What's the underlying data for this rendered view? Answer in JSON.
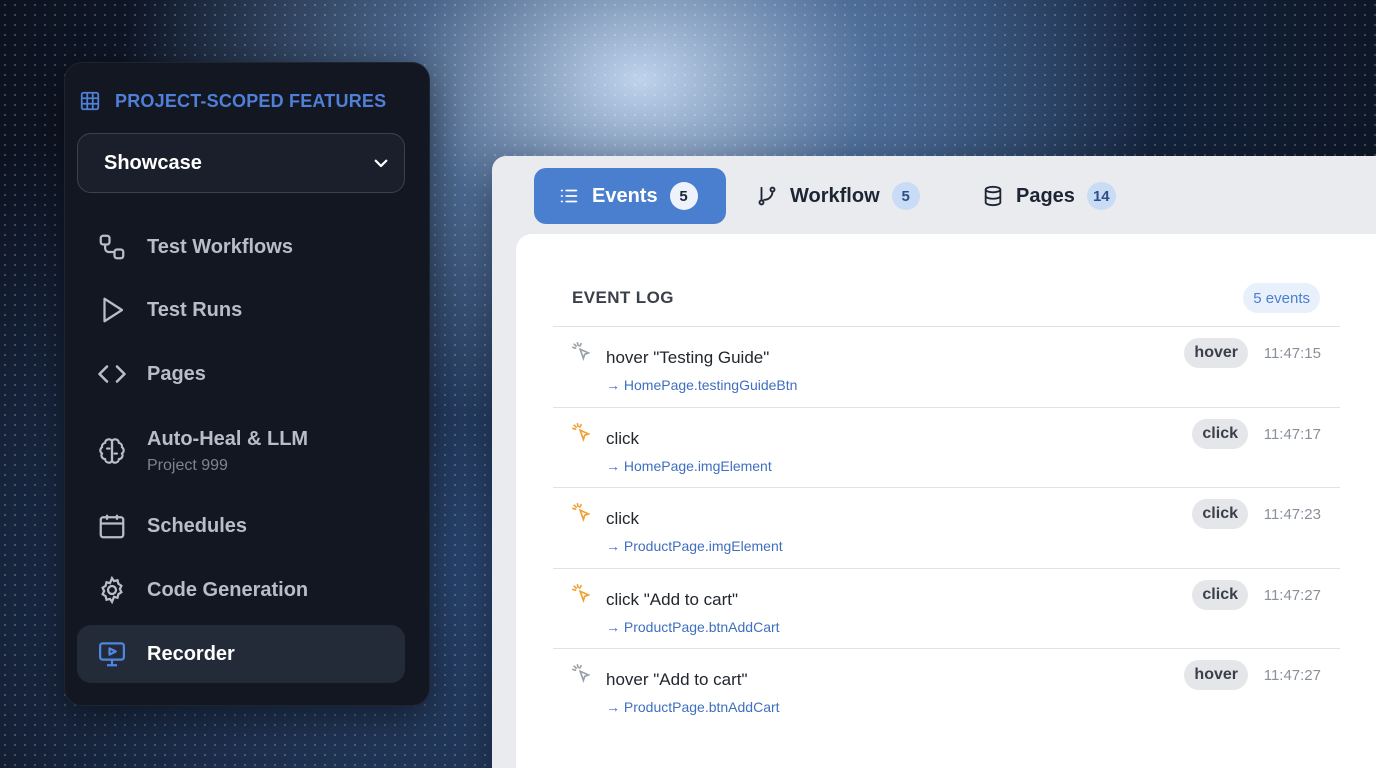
{
  "sidebar": {
    "section_title": "PROJECT-SCOPED FEATURES",
    "project_select": {
      "value": "Showcase"
    },
    "items": [
      {
        "label": "Test Workflows",
        "icon": "workflow-icon"
      },
      {
        "label": "Test Runs",
        "icon": "play-icon"
      },
      {
        "label": "Pages",
        "icon": "code-icon"
      },
      {
        "label": "Auto-Heal & LLM",
        "sublabel": "Project 999",
        "icon": "brain-icon"
      },
      {
        "label": "Schedules",
        "icon": "calendar-icon"
      },
      {
        "label": "Code Generation",
        "icon": "gear-icon"
      },
      {
        "label": "Recorder",
        "icon": "monitor-play-icon",
        "active": true
      }
    ]
  },
  "tabs": [
    {
      "label": "Events",
      "count": "5",
      "icon": "list-icon",
      "active": true
    },
    {
      "label": "Workflow",
      "count": "5",
      "icon": "branch-icon"
    },
    {
      "label": "Pages",
      "count": "14",
      "icon": "database-icon"
    }
  ],
  "event_log": {
    "title": "EVENT LOG",
    "count_label": "5 events",
    "events": [
      {
        "text": "hover \"Testing Guide\"",
        "target": "→ HomePage.testingGuideBtn",
        "type": "hover",
        "time": "11:47:15"
      },
      {
        "text": "click",
        "target": "→ HomePage.imgElement",
        "type": "click",
        "time": "11:47:17"
      },
      {
        "text": "click",
        "target": "→ ProductPage.imgElement",
        "type": "click",
        "time": "11:47:23"
      },
      {
        "text": "click \"Add to cart\"",
        "target": "→ ProductPage.btnAddCart",
        "type": "click",
        "time": "11:47:27"
      },
      {
        "text": "hover \"Add to cart\"",
        "target": "→ ProductPage.btnAddCart",
        "type": "hover",
        "time": "11:47:27"
      }
    ]
  },
  "colors": {
    "accent": "#4a7fcf",
    "click_icon": "#f0a030",
    "hover_icon": "#9aa0a8"
  }
}
